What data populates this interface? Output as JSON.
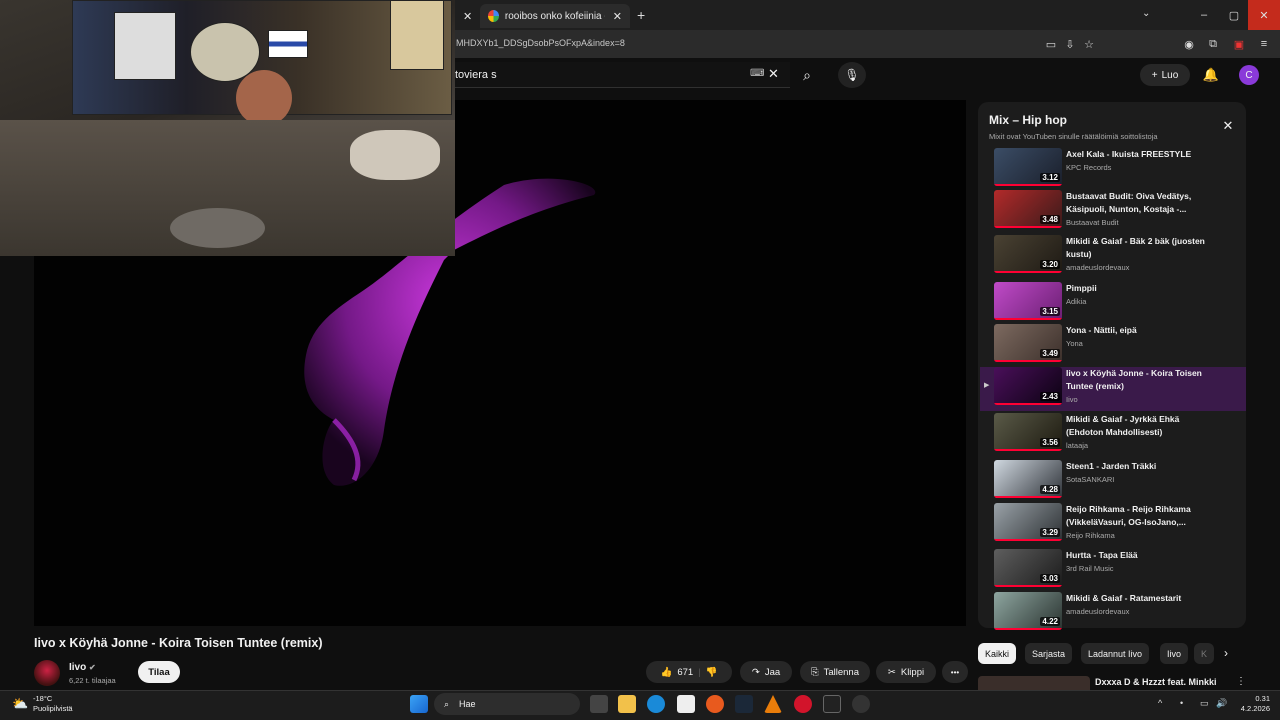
{
  "browser": {
    "tabs": [
      {
        "label": "",
        "active": false
      },
      {
        "label": "rooibos onko kofeiinia - Google",
        "active": true
      }
    ],
    "url": "MHDXYb1_DDSgDsobPsOFxpA&index=8",
    "window_controls": [
      "–",
      "▢",
      "✕"
    ]
  },
  "yt_header": {
    "search_value": "toviera s",
    "create_label": "Luo",
    "avatar_initial": "C"
  },
  "player": {
    "accent_color": "#b52bd6"
  },
  "playlist": {
    "title": "Mix – Hip hop",
    "subtitle": "Mixit ovat YouTuben sinulle räätälöimiä soittolistoja",
    "items": [
      {
        "title": "Axel Kala - Ikuista FREESTYLE",
        "channel": "KPC Records",
        "duration": "3.12",
        "current": false
      },
      {
        "title": "Bustaavat Budit: Oiva Vedätys, Käsipuoli, Nunton, Kostaja -...",
        "channel": "Bustaavat Budit",
        "duration": "3.48",
        "current": false
      },
      {
        "title": "Mikidi & Gaiaf - Bäk 2 bäk (juosten kustu)",
        "channel": "amadeuslordevaux",
        "duration": "3.20",
        "current": false
      },
      {
        "title": "Pimppii",
        "channel": "Adikia",
        "duration": "3.15",
        "current": false
      },
      {
        "title": "Yona - Nättii, eipä",
        "channel": "Yona",
        "duration": "3.49",
        "current": false
      },
      {
        "title": "Iivo x Köyhä Jonne - Koira Toisen Tuntee (remix)",
        "channel": "Iivo",
        "duration": "2.43",
        "current": true
      },
      {
        "title": "Mikidi & Gaiaf - Jyrkkä Ehkä (Ehdoton Mahdollisesti)",
        "channel": "lataaja",
        "duration": "3.56",
        "current": false
      },
      {
        "title": "Steen1 - Jarden Träkki",
        "channel": "SotaSANKARI",
        "duration": "4.28",
        "current": false
      },
      {
        "title": "Reijo Rihkama - Reijo Rihkama (VikkeläVasuri, OG-IsoJano,...",
        "channel": "Reijo Rihkama",
        "duration": "3.29",
        "current": false
      },
      {
        "title": "Hurtta - Tapa Elää",
        "channel": "3rd Rail Music",
        "duration": "3.03",
        "current": false
      },
      {
        "title": "Mikidi & Gaiaf - Ratamestarit",
        "channel": "amadeuslordevaux",
        "duration": "4.22",
        "current": false
      }
    ]
  },
  "video": {
    "title": "Iivo x Köyhä Jonne - Koira Toisen Tuntee (remix)",
    "channel": "Iivo",
    "subscribers": "6,22 t. tilaajaa",
    "subscribe_label": "Tilaa",
    "likes": "671",
    "share_label": "Jaa",
    "save_label": "Tallenna",
    "clip_label": "Klippi",
    "more_label": "•••"
  },
  "chips": [
    "Kaikki",
    "Sarjasta",
    "Ladannut Iivo",
    "Iivo",
    "K"
  ],
  "next_recommendation": "Dxxxa D & Hzzzt feat. Minkki",
  "taskbar": {
    "weather_temp": "-18°C",
    "weather_desc": "Puolipilvistä",
    "search_placeholder": "Hae",
    "time": "0.31",
    "date": "4.2.2026"
  }
}
